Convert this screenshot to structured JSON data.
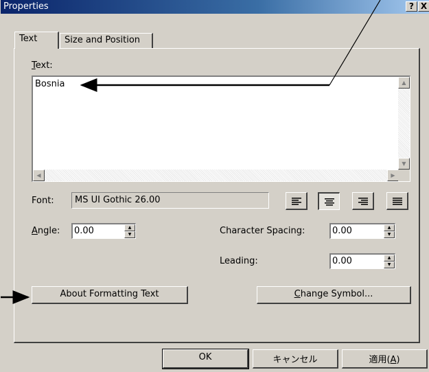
{
  "window": {
    "title": "Properties",
    "help_label": "?",
    "close_label": "X"
  },
  "tabs": [
    {
      "label": "Text",
      "active": true
    },
    {
      "label": "Size and Position",
      "active": false
    }
  ],
  "text_section": {
    "label_prefix": "T",
    "label_rest": "ext:",
    "value": "Bosnia"
  },
  "font": {
    "label": "Font:",
    "value": "MS UI Gothic 26.00"
  },
  "alignment": {
    "options": [
      "left",
      "center",
      "right",
      "justify"
    ],
    "selected": "center"
  },
  "angle": {
    "label_prefix": "A",
    "label_rest": "ngle:",
    "value": "0.00"
  },
  "character_spacing": {
    "label": "Character Spacing:",
    "value": "0.00"
  },
  "leading": {
    "label": "Leading:",
    "value": "0.00"
  },
  "buttons": {
    "about_formatting": "About Formatting Text",
    "change_symbol_prefix": "C",
    "change_symbol_rest": "hange Symbol...",
    "ok": "OK",
    "cancel": "キャンセル",
    "apply_prefix": "適用(",
    "apply_key": "A",
    "apply_suffix": ")"
  },
  "icons": {
    "up_arrow": "▲",
    "down_arrow": "▼",
    "left_arrow": "◀",
    "right_arrow": "▶"
  }
}
